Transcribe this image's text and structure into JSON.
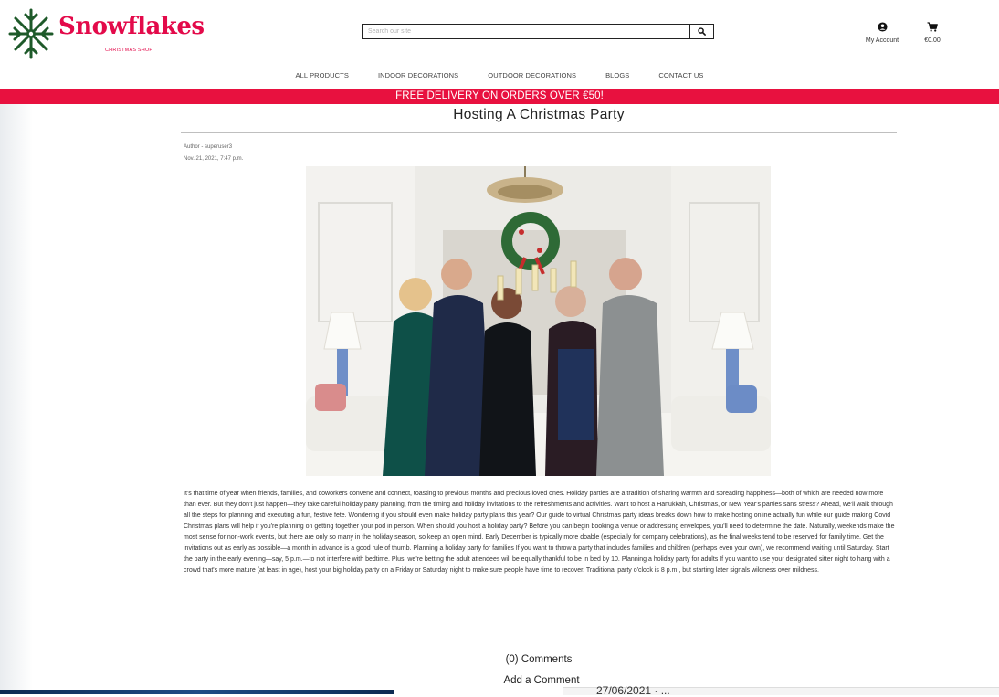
{
  "brand": {
    "name": "Snowflakes",
    "tagline": "CHRISTMAS SHOP",
    "color": "#e30a4a"
  },
  "search": {
    "placeholder": "Search our site",
    "icon": "search-icon"
  },
  "header": {
    "account_label": "My Account",
    "account_icon": "user-circle-icon",
    "cart_total": "€0.00",
    "cart_icon": "shopping-cart-icon"
  },
  "nav": {
    "items": [
      {
        "label": "ALL PRODUCTS"
      },
      {
        "label": "INDOOR DECORATIONS"
      },
      {
        "label": "OUTDOOR DECORATIONS"
      },
      {
        "label": "BLOGS"
      },
      {
        "label": "CONTACT US"
      }
    ]
  },
  "banner": {
    "text": "FREE DELIVERY ON ORDERS OVER €50!",
    "color": "#e8113f"
  },
  "post": {
    "title": "Hosting A Christmas Party",
    "author": "Author - superuser3",
    "date": "Nov. 21, 2021, 7:47 p.m.",
    "body": "It's that time of year when friends, families, and coworkers convene and connect, toasting to previous months and precious loved ones. Holiday parties are a tradition of sharing warmth and spreading happiness—both of which are needed now more than ever. But they don't just happen—they take careful holiday party planning, from the timing and holiday invitations to the refreshments and activities. Want to host a Hanukkah, Christmas, or New Year's parties sans stress? Ahead, we'll walk through all the steps for planning and executing a fun, festive fete. Wondering if you should even make holiday party plans this year? Our guide to virtual Christmas party ideas breaks down how to make hosting online actually fun while our guide making Covid Christmas plans will help if you're planning on getting together your pod in person. When should you host a holiday party? Before you can begin booking a venue or addressing envelopes, you'll need to determine the date. Naturally, weekends make the most sense for non-work events, but there are only so many in the holiday season, so keep an open mind. Early December is typically more doable (especially for company celebrations), as the final weeks tend to be reserved for family time. Get the invitations out as early as possible—a month in advance is a good rule of thumb. Planning a holiday party for families If you want to throw a party that includes families and children (perhaps even your own), we recommend waiting until Saturday. Start the party in the early evening—say, 5 p.m.—to not interfere with bedtime. Plus, we're betting the adult attendees will be equally thankful to be in bed by 10. Planning a holiday party for adults If you want to use your designated sitter night to hang with a crowd that's more mature (at least in age), host your big holiday party on a Friday or Saturday night to make sure people have time to recover. Traditional party o'clock is 8 p.m., but starting later signals wildness over mildness."
  },
  "comments": {
    "count_label": "(0) Comments",
    "add_label": "Add a Comment"
  },
  "taskbar": {
    "date_fragment": "27/06/2021 · ... "
  }
}
